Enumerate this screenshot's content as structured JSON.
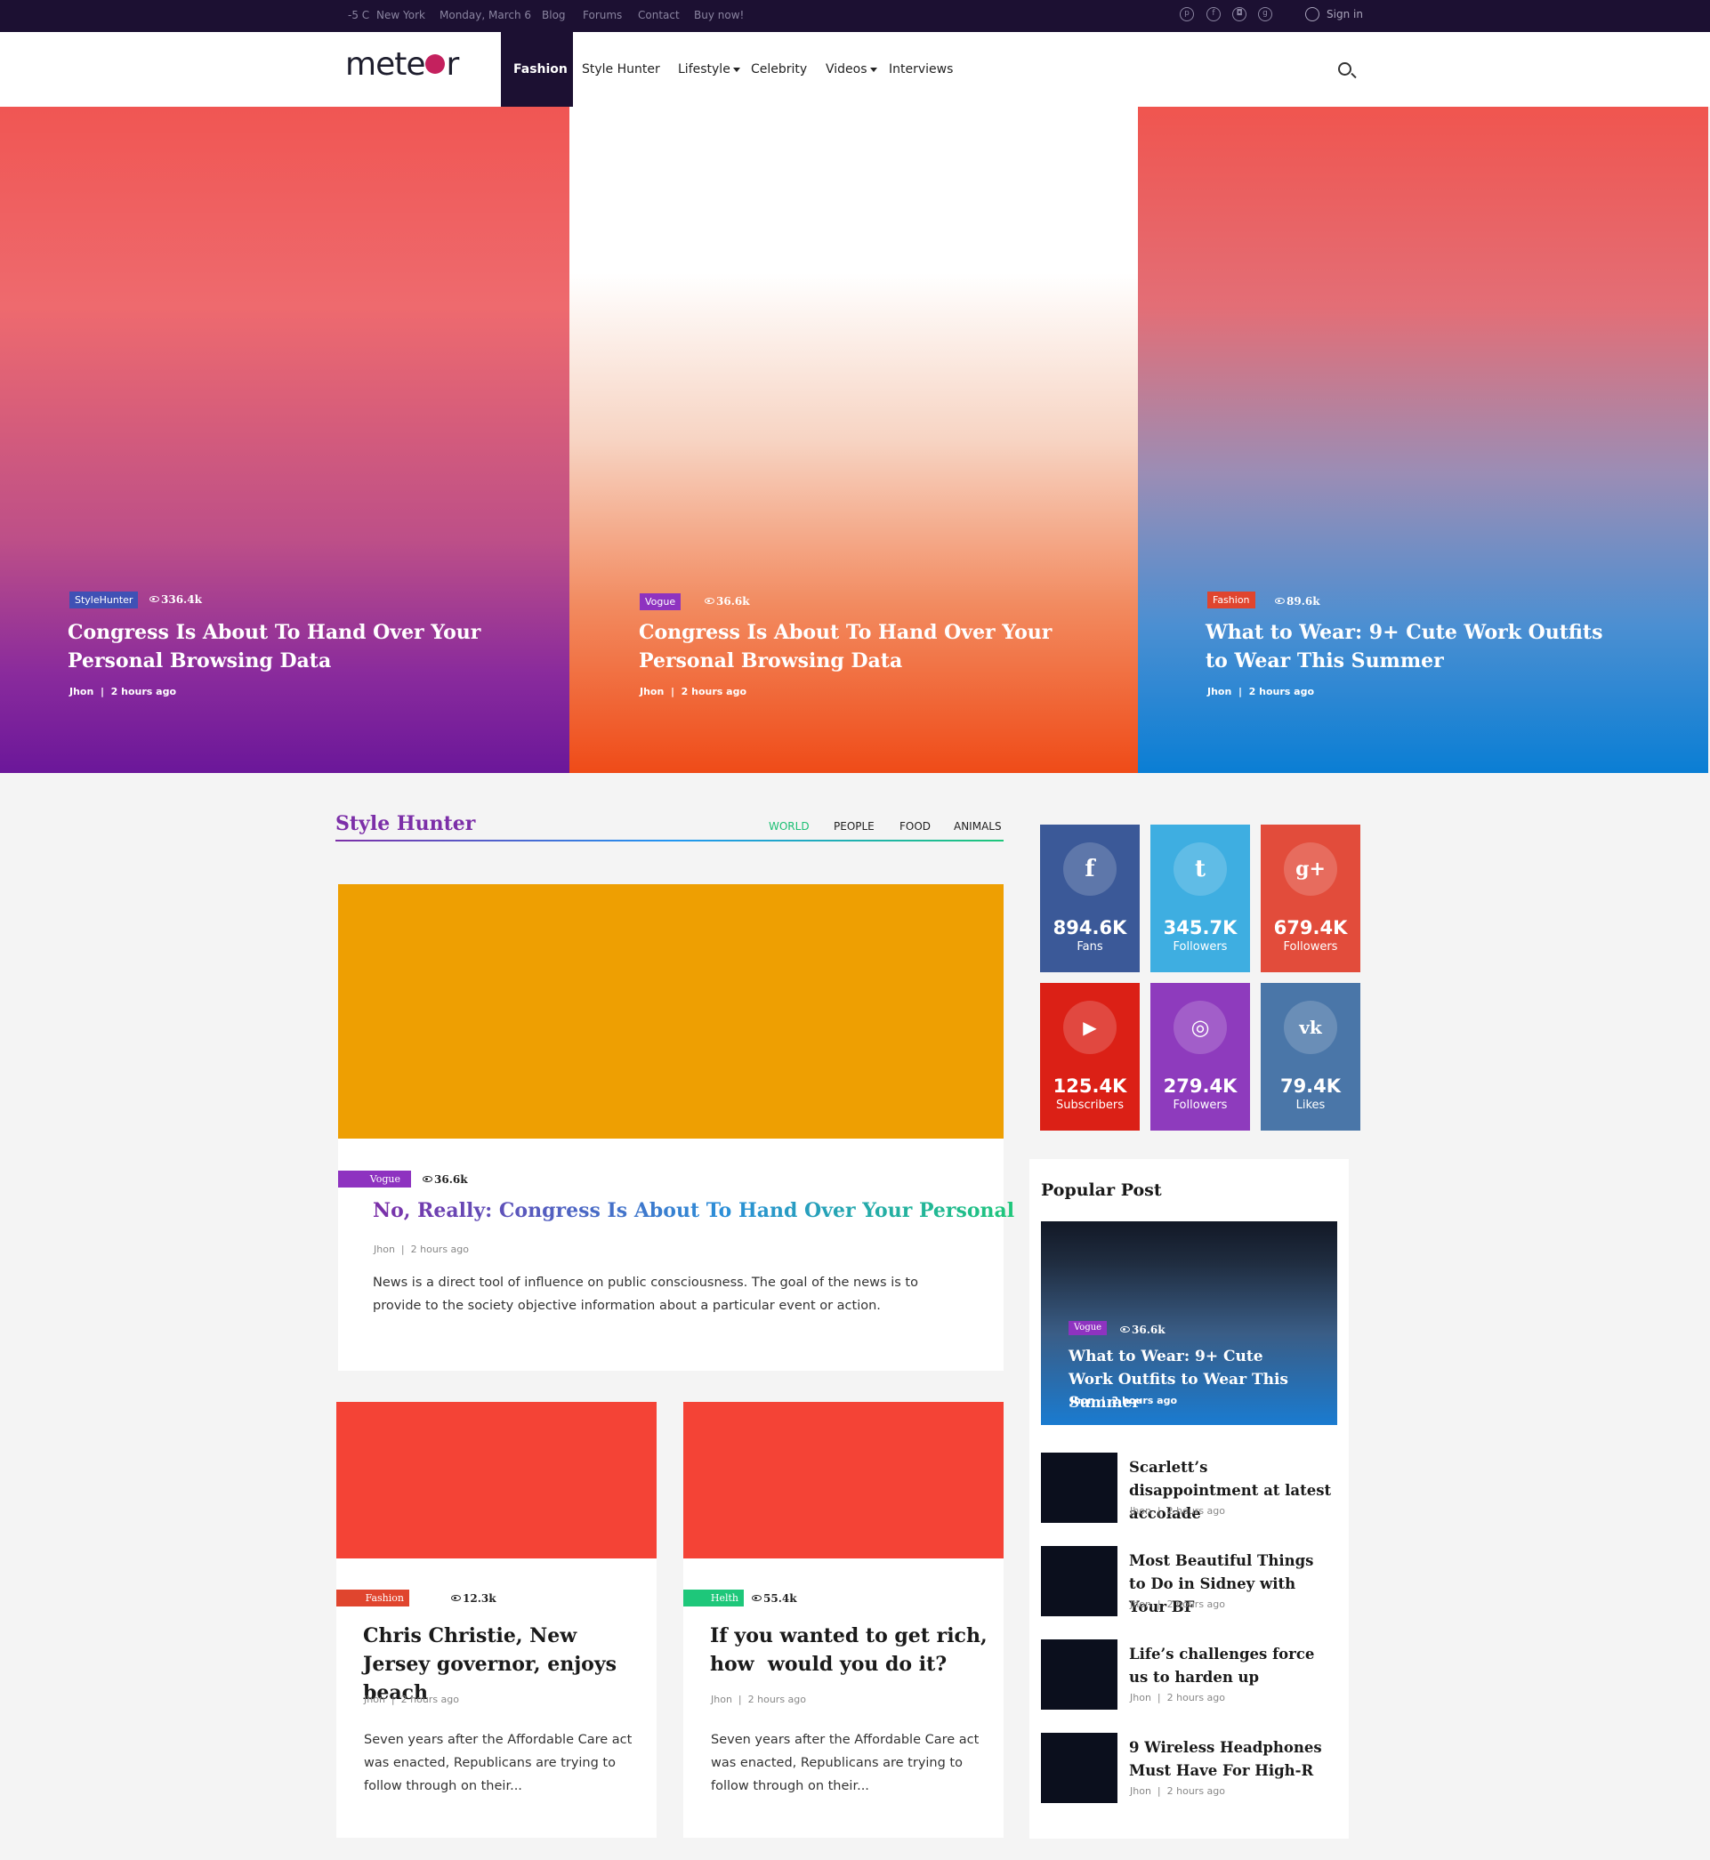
{
  "topbar": {
    "weather": "-5 C",
    "city": "New York",
    "date": "Monday, March 6",
    "links": [
      "Blog",
      "Forums",
      "Contact",
      "Buy now!"
    ],
    "signin": "Sign in",
    "social_icons": [
      "pinterest-icon",
      "facebook-icon",
      "instagram-icon",
      "google-icon"
    ]
  },
  "nav": {
    "logo": "meteor",
    "items": [
      "Fashion",
      "Style Hunter",
      "Lifestyle",
      "Celebrity",
      "Videos",
      "Interviews"
    ],
    "active": "Fashion"
  },
  "hero": [
    {
      "badge": "StyleHunter",
      "badge_color": "#3f51b5",
      "views": "336.4k",
      "title": "Congress Is About To Hand Over Your Personal Browsing Data",
      "author": "Jhon",
      "time": "2 hours ago"
    },
    {
      "badge": "Vogue",
      "badge_color": "#8e33c0",
      "views": "36.6k",
      "title": "Congress Is About To Hand Over Your Personal Browsing Data",
      "author": "Jhon",
      "time": "2 hours ago"
    },
    {
      "badge": "Fashion",
      "badge_color": "#e0452e",
      "views": "89.6k",
      "title": "What to Wear: 9+ Cute Work Outfits to Wear This Summer",
      "author": "Jhon",
      "time": "2 hours ago"
    }
  ],
  "section": {
    "title": "Style Hunter",
    "tabs": [
      "WORLD",
      "PEOPLE",
      "FOOD",
      "ANIMALS"
    ],
    "active_tab": "WORLD"
  },
  "featured": {
    "badge": "Vogue",
    "views": "36.6k",
    "title": "No, Really: Congress Is About To Hand Over Your Personal",
    "author": "Jhon",
    "time": "2 hours ago",
    "excerpt": "News is a direct tool of influence on public consciousness. The goal of the news is to provide to the society objective information about a particular event or action."
  },
  "cards": [
    {
      "badge": "Fashion",
      "badge_color": "#e0452e",
      "views": "12.3k",
      "title": "Chris Christie, New Jersey governor, enjoys beach",
      "author": "Jhon",
      "time": "2 hours ago",
      "excerpt": "Seven years after the Affordable Care act was enacted, Republicans are trying to follow through on their..."
    },
    {
      "badge": "Helth",
      "badge_color": "#1ec77a",
      "views": "55.4k",
      "title": "If you wanted to get rich, how  would you do it?",
      "author": "Jhon",
      "time": "2 hours ago",
      "excerpt": "Seven years after the Affordable Care act was enacted, Republicans are trying to follow through on their..."
    }
  ],
  "social": [
    {
      "icon": "facebook-icon",
      "glyph": "f",
      "count": "894.6K",
      "label": "Fans",
      "color": "#3b5998"
    },
    {
      "icon": "twitter-icon",
      "glyph": "t",
      "count": "345.7K",
      "label": "Followers",
      "color": "#3eaee1"
    },
    {
      "icon": "google-plus-icon",
      "glyph": "g+",
      "count": "679.4K",
      "label": "Followers",
      "color": "#e24c3b"
    },
    {
      "icon": "youtube-icon",
      "glyph": "▶",
      "count": "125.4K",
      "label": "Subscribers",
      "color": "#db2016"
    },
    {
      "icon": "instagram-icon",
      "glyph": "◎",
      "count": "279.4K",
      "label": "Followers",
      "color": "#8e3bbd"
    },
    {
      "icon": "vk-icon",
      "glyph": "vk",
      "count": "79.4K",
      "label": "Likes",
      "color": "#4a76a8"
    }
  ],
  "popular": {
    "heading": "Popular Post",
    "feature": {
      "badge": "Vogue",
      "views": "36.6k",
      "title": "What to Wear: 9+ Cute Work Outfits to Wear This Summer",
      "author": "Jhon",
      "time": "2 hours ago"
    },
    "items": [
      {
        "title": "Scarlett’s disappointment at latest accolade",
        "author": "Jhon",
        "time": "2 hours ago"
      },
      {
        "title": "Most Beautiful Things to Do in Sidney with Your BF",
        "author": "Jhon",
        "time": "2 hours ago"
      },
      {
        "title": "Life’s challenges force us to harden up",
        "author": "Jhon",
        "time": "2 hours ago"
      },
      {
        "title": "9 Wireless Headphones Must Have For High-R",
        "author": "Jhon",
        "time": "2 hours ago"
      }
    ]
  }
}
